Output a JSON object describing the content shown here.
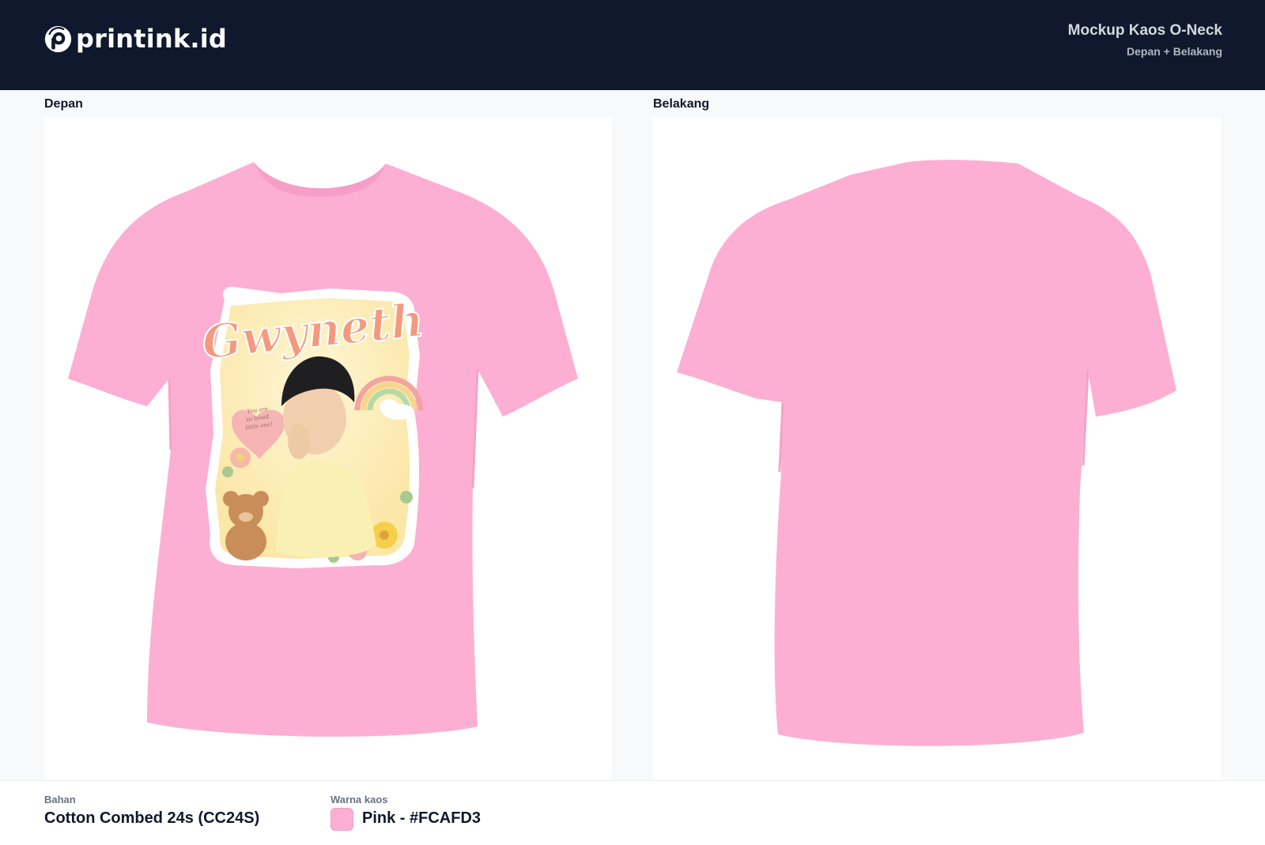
{
  "brand": {
    "name": "printink.id",
    "icon": "printink-logo-icon"
  },
  "header": {
    "title": "Mockup Kaos O-Neck",
    "subtitle": "Depan + Belakang"
  },
  "views": {
    "front": {
      "label": "Depan"
    },
    "back": {
      "label": "Belakang"
    }
  },
  "design": {
    "name_text": "Gwyneth",
    "heart_text": [
      "You are",
      "so loved,",
      "little one!"
    ]
  },
  "specs": {
    "material": {
      "label": "Bahan",
      "value": "Cotton Combed 24s (CC24S)"
    },
    "color": {
      "label": "Warna kaos",
      "value": "Pink - #FCAFD3",
      "hex": "#FCAFD3"
    }
  },
  "colors": {
    "header_bg": "#0f182c",
    "shirt": "#FCAFD3"
  }
}
